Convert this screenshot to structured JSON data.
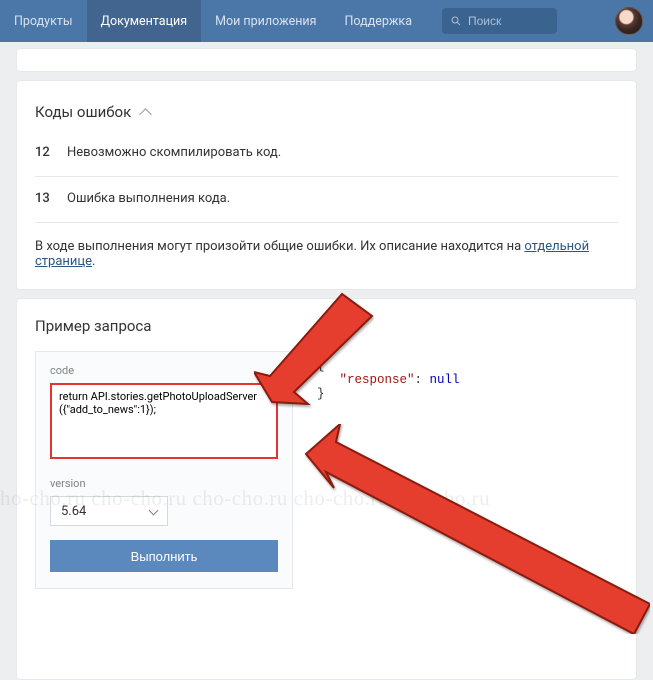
{
  "nav": {
    "items": [
      "Продукты",
      "Документация",
      "Мои приложения",
      "Поддержка"
    ],
    "active_index": 1,
    "search_placeholder": "Поиск"
  },
  "errors_section": {
    "title": "Коды ошибок",
    "rows": [
      {
        "code": "12",
        "msg": "Невозможно скомпилировать код."
      },
      {
        "code": "13",
        "msg": "Ошибка выполнения кода."
      }
    ],
    "note_prefix": "В ходе выполнения могут произойти общие ошибки. Их описание находится на ",
    "note_link": "отдельной странице",
    "note_suffix": "."
  },
  "example": {
    "title": "Пример запроса",
    "code_label": "code",
    "code_value": "return API.stories.getPhotoUploadServer({\"add_to_news\":1});",
    "version_label": "version",
    "version_value": "5.64",
    "run_label": "Выполнить",
    "response_key": "\"response\"",
    "response_val": "null"
  },
  "watermark": "ho-cho.ru  cho-cho.ru  cho-cho.ru  cho-cho.ru  cho-cho.ru"
}
